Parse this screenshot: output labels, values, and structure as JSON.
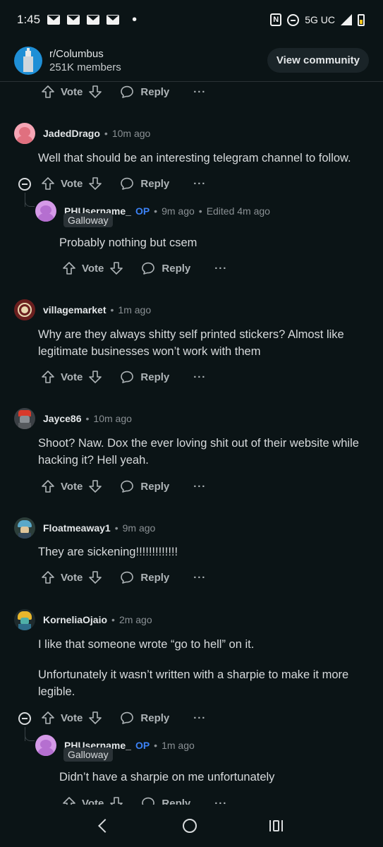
{
  "status_bar": {
    "time": "1:45",
    "network": "5G UC",
    "notification_icons": [
      "mail-icon",
      "mail-icon",
      "mail-icon",
      "mail-icon"
    ]
  },
  "header": {
    "subreddit": "r/Columbus",
    "members": "251K members",
    "view_button": "View community"
  },
  "actions": {
    "vote": "Vote",
    "reply": "Reply",
    "more": "···"
  },
  "comments": [
    {
      "username": "JadedDrago",
      "time": "10m ago",
      "body": [
        "Well that should be an interesting telegram channel to follow."
      ]
    },
    {
      "username": "PHUsername_",
      "op_badge": "OP",
      "time": "9m ago",
      "edited": "Edited 4m ago",
      "flair": "Galloway",
      "body": [
        "Probably nothing but csem"
      ]
    },
    {
      "username": "villagemarket",
      "time": "1m ago",
      "body": [
        "Why are they always shitty self printed stickers? Almost like legitimate businesses won’t work with them"
      ]
    },
    {
      "username": "Jayce86",
      "time": "10m ago",
      "body": [
        "Shoot? Naw. Dox the ever loving shit out of their website while hacking it? Hell yeah."
      ]
    },
    {
      "username": "Floatmeaway1",
      "time": "9m ago",
      "body": [
        "They are sickening!!!!!!!!!!!!!"
      ]
    },
    {
      "username": "KorneliaOjaio",
      "time": "2m ago",
      "body": [
        "I like that someone wrote “go to hell” on it.",
        "Unfortunately it wasn’t written with a sharpie to make it more legible."
      ]
    },
    {
      "username": "PHUsername_",
      "op_badge": "OP",
      "time": "1m ago",
      "flair": "Galloway",
      "body": [
        "Didn’t have a sharpie on me unfortunately"
      ]
    }
  ],
  "colors": {
    "background": "#0b1416",
    "op_badge": "#3c82f6",
    "text": "#d7dadc",
    "meta": "#8a9094"
  }
}
